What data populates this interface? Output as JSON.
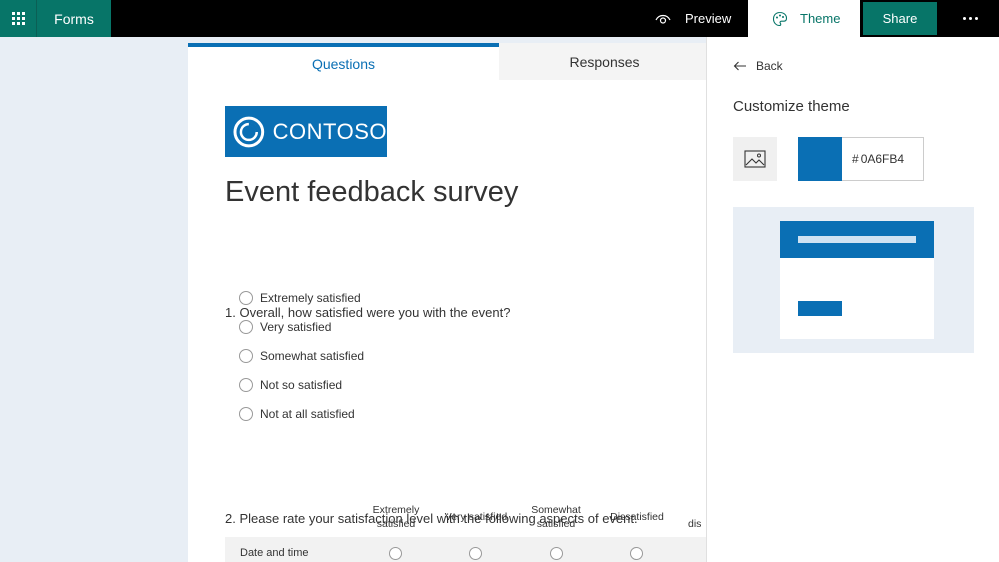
{
  "app": {
    "name": "Forms"
  },
  "topbar": {
    "preview_label": "Preview",
    "theme_label": "Theme",
    "share_label": "Share"
  },
  "tabs": {
    "questions": "Questions",
    "responses": "Responses"
  },
  "form": {
    "logo_text": "CONTOSO",
    "title": "Event feedback survey",
    "q1": {
      "text": "1. Overall, how satisfied were you with the event?",
      "options": [
        "Extremely satisfied",
        "Very satisfied",
        "Somewhat satisfied",
        "Not so satisfied",
        "Not at all satisfied"
      ]
    },
    "q2": {
      "text": "2. Please rate your satisfaction level with the following aspects of event.",
      "columns": [
        "Extremely satisfied",
        "Very satisfied",
        "Somewhat satisfied",
        "Dissatisfied",
        "dis"
      ],
      "rows": [
        "Date and time"
      ]
    }
  },
  "panel": {
    "back_label": "Back",
    "title": "Customize theme",
    "color_hash": "#",
    "color_value": "0A6FB4"
  },
  "colors": {
    "accent": "#077568",
    "theme": "#0a6fb4"
  }
}
